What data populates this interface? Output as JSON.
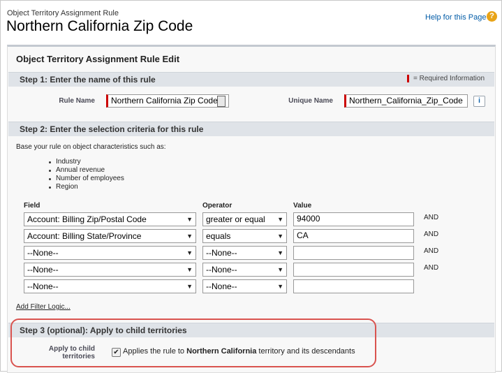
{
  "header": {
    "object_label": "Object Territory Assignment Rule",
    "title": "Northern California Zip Code",
    "help_link": "Help for this Page",
    "help_icon": "?"
  },
  "panel": {
    "title": "Object Territory Assignment Rule Edit"
  },
  "step1": {
    "title": "Step 1: Enter the name of this rule",
    "required_info": "= Required Information",
    "rule_name_label": "Rule Name",
    "rule_name_value": "Northern California Zip Code",
    "unique_name_label": "Unique Name",
    "unique_name_value": "Northern_California_Zip_Code",
    "info_icon": "i"
  },
  "step2": {
    "title": "Step 2: Enter the selection criteria for this rule",
    "intro": "Base your rule on object characteristics such as:",
    "examples": [
      "Industry",
      "Annual revenue",
      "Number of employees",
      "Region"
    ],
    "headers": {
      "field": "Field",
      "operator": "Operator",
      "value": "Value"
    },
    "rows": [
      {
        "field": "Account: Billing Zip/Postal Code",
        "operator": "greater or equal",
        "value": "94000",
        "logic": "AND"
      },
      {
        "field": "Account: Billing State/Province",
        "operator": "equals",
        "value": "CA",
        "logic": "AND"
      },
      {
        "field": "--None--",
        "operator": "--None--",
        "value": "",
        "logic": "AND"
      },
      {
        "field": "--None--",
        "operator": "--None--",
        "value": "",
        "logic": "AND"
      },
      {
        "field": "--None--",
        "operator": "--None--",
        "value": "",
        "logic": ""
      }
    ],
    "add_filter_logic": "Add Filter Logic..."
  },
  "step3": {
    "title": "Step 3 (optional): Apply to child territories",
    "label_line1": "Apply to child",
    "label_line2": "territories",
    "checked": true,
    "checkbox_text_before": "Applies the rule to ",
    "checkbox_text_bold": "Northern California",
    "checkbox_text_after": " territory and its descendants"
  },
  "colors": {
    "required": "#cc0000",
    "highlight": "#d9534f",
    "link": "#015ba7",
    "help_icon": "#e8a317"
  }
}
